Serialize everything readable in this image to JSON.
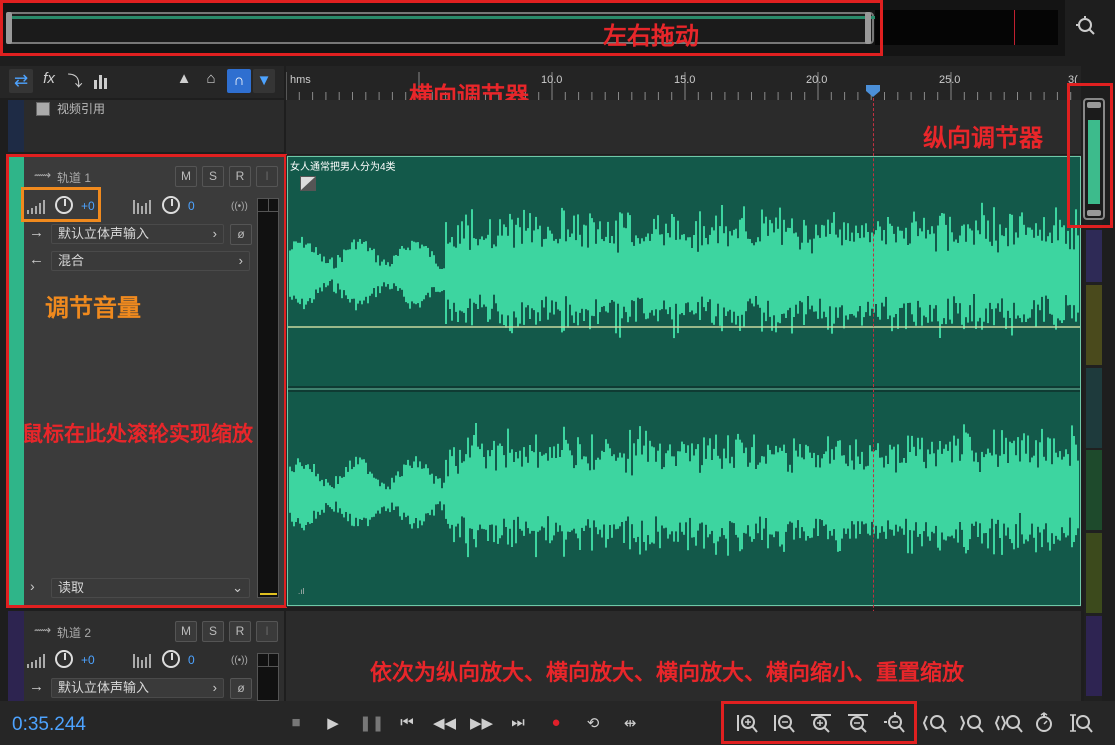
{
  "overview": {
    "annotation": "左右拖动"
  },
  "ruler": {
    "unit_label": "hms",
    "ticks": [
      "10.0",
      "15.0",
      "20.0",
      "25.0",
      "3("
    ],
    "annotation": "横向调节器"
  },
  "toolbar": {
    "icons": [
      "switch-icon",
      "fx-icon",
      "routing-icon",
      "meter-icon",
      "metronome-icon",
      "punch-icon",
      "headphones-icon",
      "marker-icon"
    ]
  },
  "video_track": {
    "label": "视频引用"
  },
  "track1": {
    "name": "轨道 1",
    "m": "M",
    "s": "S",
    "r": "R",
    "i": "I",
    "volume_value": "+0",
    "pan_value": "0",
    "stereo_symbol": "((•))",
    "input": "默认立体声输入",
    "output": "混合",
    "automation": "读取",
    "clip_title": "女人通常把男人分为4类"
  },
  "track2": {
    "name": "轨道 2",
    "m": "M",
    "s": "S",
    "r": "R",
    "i": "I",
    "volume_value": "+0",
    "pan_value": "0",
    "stereo_symbol": "((•))",
    "input": "默认立体声输入"
  },
  "annotations": {
    "vertical_regulator": "纵向调节器",
    "adjust_volume": "调节音量",
    "scroll_zoom": "鼠标在此处滚轮实现缩放",
    "zoom_buttons": "依次为纵向放大、横向放大、横向放大、横向缩小、重置缩放"
  },
  "status": {
    "time": "0:35.244"
  },
  "colors": {
    "waveform": "#3dd5a0",
    "clip_bg": "#13594a",
    "track_accent": "#2fb589",
    "annotation_red": "#e8262a",
    "annotation_orange": "#f08a1e",
    "time_blue": "#4da3ff"
  }
}
